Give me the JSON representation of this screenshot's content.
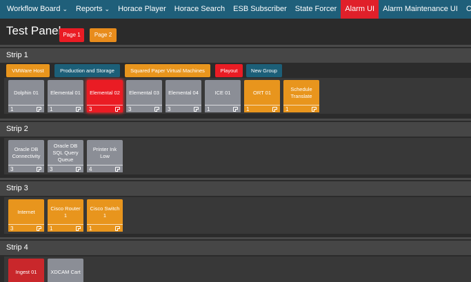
{
  "nav": {
    "items": [
      {
        "label": "Workflow Board",
        "chevron": true
      },
      {
        "label": "Reports",
        "chevron": true
      },
      {
        "label": "Horace Player",
        "chevron": false
      },
      {
        "label": "Horace Search",
        "chevron": false
      },
      {
        "label": "ESB Subscriber",
        "chevron": false
      },
      {
        "label": "State Forcer",
        "chevron": false
      },
      {
        "label": "Alarm UI",
        "chevron": false,
        "active": true
      },
      {
        "label": "Alarm Maintenance UI",
        "chevron": false
      },
      {
        "label": "Current Alarms Ui",
        "chevron": false
      }
    ],
    "chevron_glyph": "⌄"
  },
  "header": {
    "title": "Test Panel",
    "pages": [
      "Page 1",
      "Page 2"
    ]
  },
  "strips": [
    {
      "title": "Strip 1",
      "groups": [
        "VMWare Host",
        "Production and Storage",
        "Squared Paper Virtual Machines",
        "Playout",
        "New Group"
      ],
      "tiles": [
        {
          "label": "Dolphin 01",
          "count": "1"
        },
        {
          "label": "Elemental 01",
          "count": "1"
        },
        {
          "label": "Elemental 02",
          "count": "3"
        },
        {
          "label": "Elemental 03",
          "count": "3"
        },
        {
          "label": "Elemental 04",
          "count": "3"
        },
        {
          "label": "ICE 01",
          "count": "1"
        },
        {
          "label": "ORT 01",
          "count": "1"
        },
        {
          "label": "Schedule Translate",
          "count": "1"
        }
      ]
    },
    {
      "title": "Strip 2",
      "tiles": [
        {
          "label": "Oracle DB Connectivity",
          "count": "3"
        },
        {
          "label": "Oracle DB SQL Query Queue",
          "count": "3"
        },
        {
          "label": "Printer Ink Low",
          "count": "4"
        }
      ]
    },
    {
      "title": "Strip 3",
      "tiles": [
        {
          "label": "Internet",
          "count": "3"
        },
        {
          "label": "Cisco Router 1",
          "count": "1"
        },
        {
          "label": "Cisco Switch 1",
          "count": "1"
        }
      ]
    },
    {
      "title": "Strip 4",
      "tiles": [
        {
          "label": "Ingest 01"
        },
        {
          "label": "XDCAM Cart"
        }
      ]
    }
  ],
  "colors": {
    "nav_bg": "#1f5f7a",
    "active_red": "#ea1c24",
    "orange": "#e8951d",
    "teal": "#1c5f78",
    "gray_tile": "#8b8e96",
    "dark_red": "#c9272b"
  }
}
